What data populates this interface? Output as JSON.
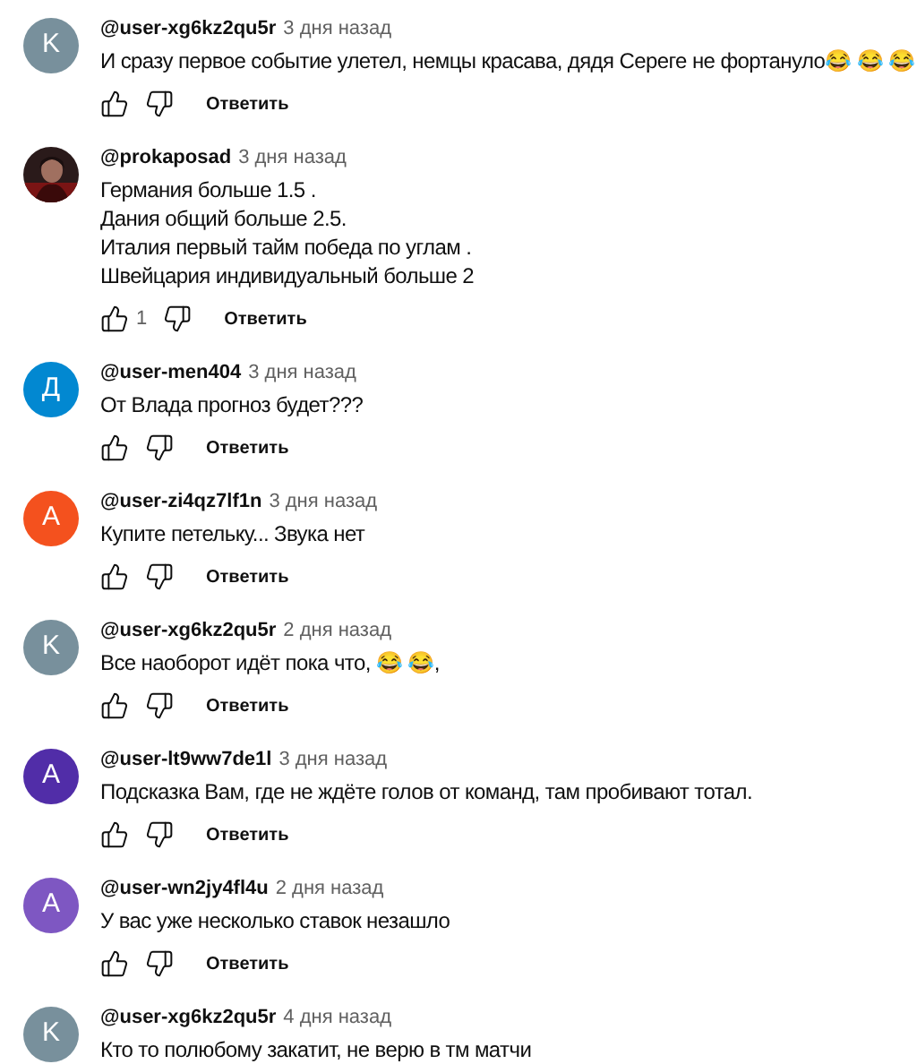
{
  "comments": [
    {
      "avatar": {
        "kind": "letter",
        "letter": "K",
        "color": "#78909c"
      },
      "author": "@user-xg6kz2qu5r",
      "time": "3 дня назад",
      "lines": [
        "И сразу первое событие улетел, немцы красава, дядя Сереге не фортануло😂 😂 😂"
      ],
      "reply": "Ответить"
    },
    {
      "author": "@prokaposad",
      "time": "3 дня назад",
      "lines": [
        "Германия больше 1.5 .",
        "Дания общий больше 2.5.",
        "Италия первый тайм победа по углам .",
        "Швейцария индивидуальный больше 2"
      ],
      "likes": "1",
      "reply": "Ответить"
    },
    {
      "avatar": {
        "kind": "letter",
        "letter": "Д",
        "color": "#0288d1"
      },
      "author": "@user-men404",
      "time": "3 дня назад",
      "lines": [
        "От Влада прогноз будет???"
      ],
      "reply": "Ответить"
    },
    {
      "avatar": {
        "kind": "letter",
        "letter": "A",
        "color": "#f4511e"
      },
      "author": "@user-zi4qz7lf1n",
      "time": "3 дня назад",
      "lines": [
        "Купите петельку... Звука нет"
      ],
      "reply": "Ответить"
    },
    {
      "avatar": {
        "kind": "letter",
        "letter": "K",
        "color": "#78909c"
      },
      "author": "@user-xg6kz2qu5r",
      "time": "2 дня назад",
      "lines": [
        "Все наоборот идёт пока что, 😂 😂,"
      ],
      "reply": "Ответить"
    },
    {
      "avatar": {
        "kind": "letter",
        "letter": "A",
        "color": "#512da8"
      },
      "author": "@user-lt9ww7de1l",
      "time": "3 дня назад",
      "lines": [
        "Подсказка Вам, где не ждёте голов от команд, там пробивают тотал."
      ],
      "reply": "Ответить"
    },
    {
      "avatar": {
        "kind": "letter",
        "letter": "A",
        "color": "#7e57c2"
      },
      "author": "@user-wn2jy4fl4u",
      "time": "2 дня назад",
      "lines": [
        "У вас уже несколько ставок незашло"
      ],
      "reply": "Ответить"
    },
    {
      "avatar": {
        "kind": "letter",
        "letter": "K",
        "color": "#78909c"
      },
      "author": "@user-xg6kz2qu5r",
      "time": "4 дня назад",
      "lines": [
        "Кто то полюбому закатит, не верю в тм матчи"
      ]
    }
  ]
}
